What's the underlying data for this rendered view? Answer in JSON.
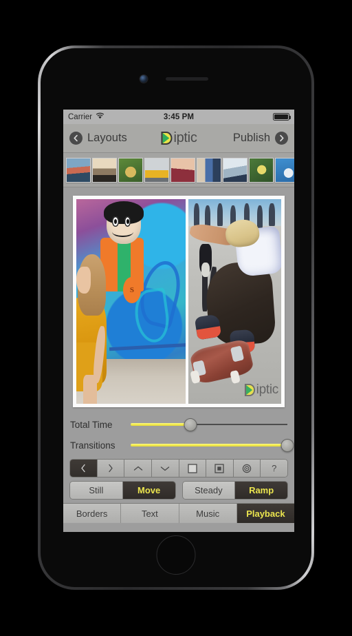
{
  "status_bar": {
    "carrier": "Carrier",
    "wifi_icon": "wifi-icon",
    "time": "3:45 PM",
    "battery_icon": "battery-full-icon"
  },
  "nav_bar": {
    "back_label": "Layouts",
    "back_icon": "chevron-left-circle-icon",
    "brand": "iptic",
    "brand_logo": "diptic-d-logo",
    "publish_label": "Publish",
    "publish_icon": "chevron-right-circle-icon"
  },
  "thumb_strip": {
    "add_icon": "plus-icon",
    "thumbnails": [
      {
        "name": "thumb-pier-sunset",
        "c1": "#7ea6c4",
        "c2": "#c96a52",
        "c3": "#2e4a63"
      },
      {
        "name": "thumb-city-dusk",
        "c1": "#e8d9bf",
        "c2": "#8d7a62",
        "c3": "#2a2622"
      },
      {
        "name": "thumb-vegetables",
        "c1": "#5d8a3a",
        "c2": "#d8b95e",
        "c3": "#3a5e2a"
      },
      {
        "name": "thumb-yellow-car",
        "c1": "#cfd3d6",
        "c2": "#e8b324",
        "c3": "#6a6f74"
      },
      {
        "name": "thumb-portrait-red",
        "c1": "#e8c3a8",
        "c2": "#8d2f3c",
        "c3": "#c08f74"
      },
      {
        "name": "thumb-street-crowd",
        "c1": "#4a6fa8",
        "c2": "#d8c9b4",
        "c3": "#2c3f5c"
      },
      {
        "name": "thumb-snow-jump",
        "c1": "#dfe8ee",
        "c2": "#2a3a52",
        "c3": "#9fb4c4"
      },
      {
        "name": "thumb-garden-duck",
        "c1": "#4d7a3a",
        "c2": "#e8d96a",
        "c3": "#2f5228"
      },
      {
        "name": "thumb-ferris-wheel",
        "c1": "#3f8fd0",
        "c2": "#e8eef4",
        "c3": "#2a6ba8"
      }
    ]
  },
  "collage": {
    "left_pane_name": "collage-pane-left-graffiti-woman",
    "right_pane_name": "collage-pane-right-skateboarder",
    "watermark_brand": "iptic",
    "watermark_logo": "diptic-d-logo",
    "coin_letter": "S"
  },
  "sliders": [
    {
      "name": "total-time-slider",
      "label": "Total Time",
      "value_percent": 38
    },
    {
      "name": "transitions-slider",
      "label": "Transitions",
      "value_percent": 100
    }
  ],
  "icon_row": [
    {
      "name": "prev-button",
      "icon": "chevron-left-icon",
      "active": true
    },
    {
      "name": "next-button",
      "icon": "chevron-right-icon",
      "active": false
    },
    {
      "name": "move-up-button",
      "icon": "chevron-up-icon",
      "active": false
    },
    {
      "name": "move-down-button",
      "icon": "chevron-down-icon",
      "active": false
    },
    {
      "name": "fill-frame-button",
      "icon": "filled-square-icon",
      "active": false
    },
    {
      "name": "fit-frame-button",
      "icon": "nested-square-icon",
      "active": false
    },
    {
      "name": "focus-point-button",
      "icon": "target-circles-icon",
      "active": false
    },
    {
      "name": "help-button",
      "icon": "question-mark-icon",
      "active": false,
      "label": "?"
    }
  ],
  "segments": [
    {
      "name": "motion-segmented-control",
      "options": [
        {
          "name": "segment-still",
          "label": "Still",
          "active": false
        },
        {
          "name": "segment-move",
          "label": "Move",
          "active": true
        }
      ]
    },
    {
      "name": "easing-segmented-control",
      "options": [
        {
          "name": "segment-steady",
          "label": "Steady",
          "active": false
        },
        {
          "name": "segment-ramp",
          "label": "Ramp",
          "active": true
        }
      ]
    }
  ],
  "tabs": [
    {
      "name": "tab-borders",
      "label": "Borders",
      "active": false
    },
    {
      "name": "tab-text",
      "label": "Text",
      "active": false
    },
    {
      "name": "tab-music",
      "label": "Music",
      "active": false
    },
    {
      "name": "tab-playback",
      "label": "Playback",
      "active": true
    }
  ],
  "colors": {
    "accent_yellow": "#ebe54e",
    "slider_yellow": "#f2ea4e",
    "active_dark": "#332f2c",
    "chrome_gray": "#9d9d9d"
  }
}
